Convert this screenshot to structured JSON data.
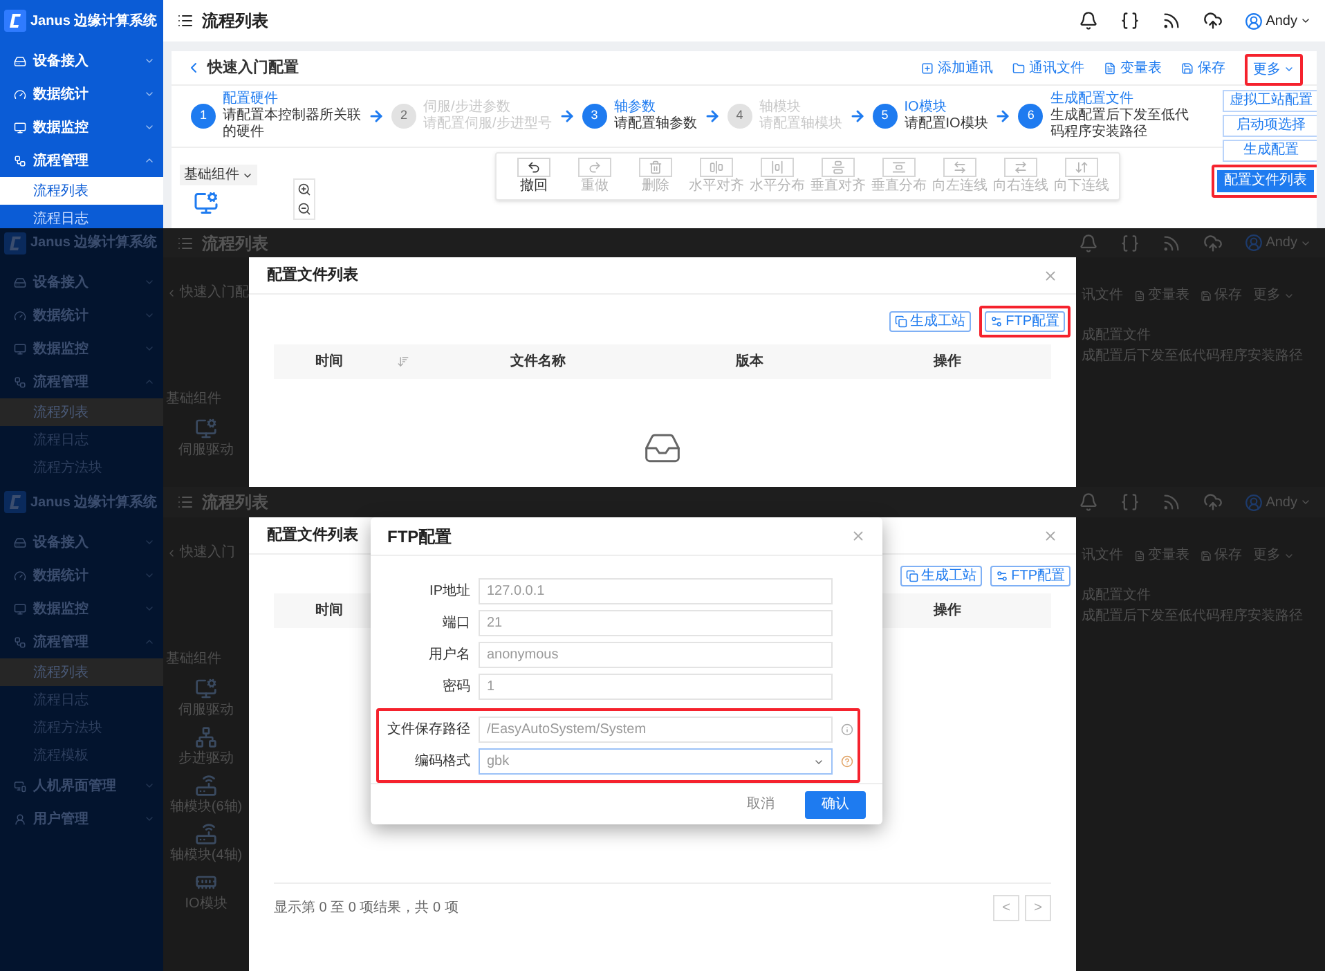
{
  "panels": [
    {
      "kind": "editor",
      "sidebar": {
        "brand": "Janus 边缘计算系统",
        "items": [
          {
            "label": "设备接入",
            "expanded": false
          },
          {
            "label": "数据统计",
            "expanded": false
          },
          {
            "label": "数据监控",
            "expanded": false
          },
          {
            "label": "流程管理",
            "expanded": true,
            "children": [
              {
                "label": "流程列表",
                "selected": true
              },
              {
                "label": "流程日志",
                "selected": false
              }
            ]
          }
        ]
      },
      "header": {
        "title": "流程列表",
        "user": "Andy"
      },
      "page": {
        "back_title": "快速入门配置",
        "actions": [
          {
            "label": "添加通讯",
            "kind": "add"
          },
          {
            "label": "通讯文件",
            "kind": "file"
          },
          {
            "label": "变量表",
            "kind": "variables"
          },
          {
            "label": "保存",
            "kind": "save"
          }
        ],
        "more": {
          "label": "更多",
          "highlighted": true,
          "menu": [
            {
              "label": "虚拟工站配置",
              "selected": false,
              "highlighted": false
            },
            {
              "label": "启动项选择",
              "selected": false,
              "highlighted": false
            },
            {
              "label": "生成配置",
              "selected": false,
              "highlighted": false
            },
            {
              "label": "配置文件列表",
              "selected": true,
              "highlighted": true
            }
          ]
        },
        "steps": [
          {
            "number": "1",
            "title": "配置硬件",
            "desc": "请配置本控制器所关联的硬件",
            "active": true
          },
          {
            "number": "2",
            "title": "伺服/步进参数",
            "desc": "请配置伺服/步进型号",
            "active": false
          },
          {
            "number": "3",
            "title": "轴参数",
            "desc": "请配置轴参数",
            "active": true
          },
          {
            "number": "4",
            "title": "轴模块",
            "desc": "请配置轴模块",
            "active": false
          },
          {
            "number": "5",
            "title": "IO模块",
            "desc": "请配置IO模块",
            "active": true
          },
          {
            "number": "6",
            "title": "生成配置文件",
            "desc": "生成配置后下发至低代码程序安装路径",
            "active": true
          }
        ],
        "toolbar": [
          {
            "label": "撤回",
            "disabled": false
          },
          {
            "label": "重做",
            "disabled": true
          },
          {
            "label": "删除",
            "disabled": true
          },
          {
            "label": "水平对齐",
            "disabled": true
          },
          {
            "label": "水平分布",
            "disabled": true
          },
          {
            "label": "垂直对齐",
            "disabled": true
          },
          {
            "label": "垂直分布",
            "disabled": true
          },
          {
            "label": "向左连线",
            "disabled": true
          },
          {
            "label": "向右连线",
            "disabled": true
          },
          {
            "label": "向下连线",
            "disabled": true
          }
        ],
        "palette_title": "基础组件"
      }
    },
    {
      "kind": "file_list",
      "sidebar": {
        "brand": "Janus 边缘计算系统",
        "items": [
          {
            "label": "设备接入",
            "expanded": false
          },
          {
            "label": "数据统计",
            "expanded": false
          },
          {
            "label": "数据监控",
            "expanded": false
          },
          {
            "label": "流程管理",
            "expanded": true,
            "children": [
              {
                "label": "流程列表",
                "selected": true
              },
              {
                "label": "流程日志",
                "selected": false
              },
              {
                "label": "流程方法块",
                "selected": false
              }
            ]
          }
        ]
      },
      "header": {
        "title": "流程列表",
        "user": "Andy"
      },
      "left": {
        "back_title": "快速入门配",
        "palette_title": "基础组件",
        "palette_items": [
          "伺服驱动"
        ]
      },
      "right": {
        "actions": [
          {
            "label": "讯文件",
            "kind": "file_cut"
          },
          {
            "label": "变量表",
            "kind": "variables"
          },
          {
            "label": "保存",
            "kind": "save"
          },
          {
            "label": "更多",
            "kind": "more"
          }
        ],
        "step_title": "成配置文件",
        "step_desc": "成配置后下发至低代码程序安装路径"
      },
      "dialog": {
        "title": "配置文件列表",
        "buttons": [
          {
            "label": "生成工站",
            "highlighted": false
          },
          {
            "label": "FTP配置",
            "highlighted": true
          }
        ],
        "columns": [
          {
            "label": "时间",
            "kind": "time",
            "sortable": true
          },
          {
            "label": "文件名称",
            "kind": "name"
          },
          {
            "label": "版本",
            "kind": "version"
          },
          {
            "label": "操作",
            "kind": "action"
          }
        ],
        "empty": true
      }
    },
    {
      "kind": "ftp",
      "sidebar": {
        "brand": "Janus 边缘计算系统",
        "items": [
          {
            "label": "设备接入",
            "expanded": false
          },
          {
            "label": "数据统计",
            "expanded": false
          },
          {
            "label": "数据监控",
            "expanded": false
          },
          {
            "label": "流程管理",
            "expanded": true,
            "children": [
              {
                "label": "流程列表",
                "selected": true
              },
              {
                "label": "流程日志",
                "selected": false
              },
              {
                "label": "流程方法块",
                "selected": false
              },
              {
                "label": "流程模板",
                "selected": false
              }
            ]
          },
          {
            "label": "人机界面管理",
            "expanded": false
          },
          {
            "label": "用户管理",
            "expanded": false
          }
        ]
      },
      "header": {
        "title": "流程列表",
        "user": "Andy"
      },
      "left": {
        "back_title": "快速入门",
        "palette_title": "基础组件",
        "palette_items": [
          "伺服驱动",
          "步进驱动",
          "轴模块(6轴)",
          "轴模块(4轴)",
          "IO模块"
        ]
      },
      "right": {
        "actions": [
          {
            "label": "讯文件",
            "kind": "file_cut"
          },
          {
            "label": "变量表",
            "kind": "variables"
          },
          {
            "label": "保存",
            "kind": "save"
          },
          {
            "label": "更多",
            "kind": "more"
          }
        ],
        "step_title": "成配置文件",
        "step_desc": "成配置后下发至低代码程序安装路径"
      },
      "dialog": {
        "title": "配置文件列表",
        "buttons": [
          {
            "label": "生成工站",
            "highlighted": false
          },
          {
            "label": "FTP配置",
            "highlighted": false
          }
        ],
        "columns": [
          {
            "label": "时间",
            "kind": "time"
          },
          {
            "label": "操作",
            "kind": "action"
          }
        ],
        "footer": "显示第 0 至 0 项结果，共 0 项",
        "pager": [
          "<",
          ">"
        ]
      },
      "ftp_dialog": {
        "title": "FTP配置",
        "fields": [
          {
            "label": "IP地址",
            "value": "127.0.0.1",
            "kind": "text",
            "highlighted": false
          },
          {
            "label": "端口",
            "value": "21",
            "kind": "text",
            "highlighted": false
          },
          {
            "label": "用户名",
            "value": "anonymous",
            "kind": "text",
            "highlighted": false
          },
          {
            "label": "密码",
            "value": "1",
            "kind": "text",
            "highlighted": false
          },
          {
            "label": "文件保存路径",
            "value": "/EasyAutoSystem/System",
            "kind": "path",
            "highlighted": true
          },
          {
            "label": "编码格式",
            "value": "gbk",
            "kind": "select",
            "highlighted": true
          }
        ],
        "buttons": [
          {
            "label": "取消",
            "kind": "secondary"
          },
          {
            "label": "确认",
            "kind": "primary"
          }
        ]
      }
    }
  ]
}
